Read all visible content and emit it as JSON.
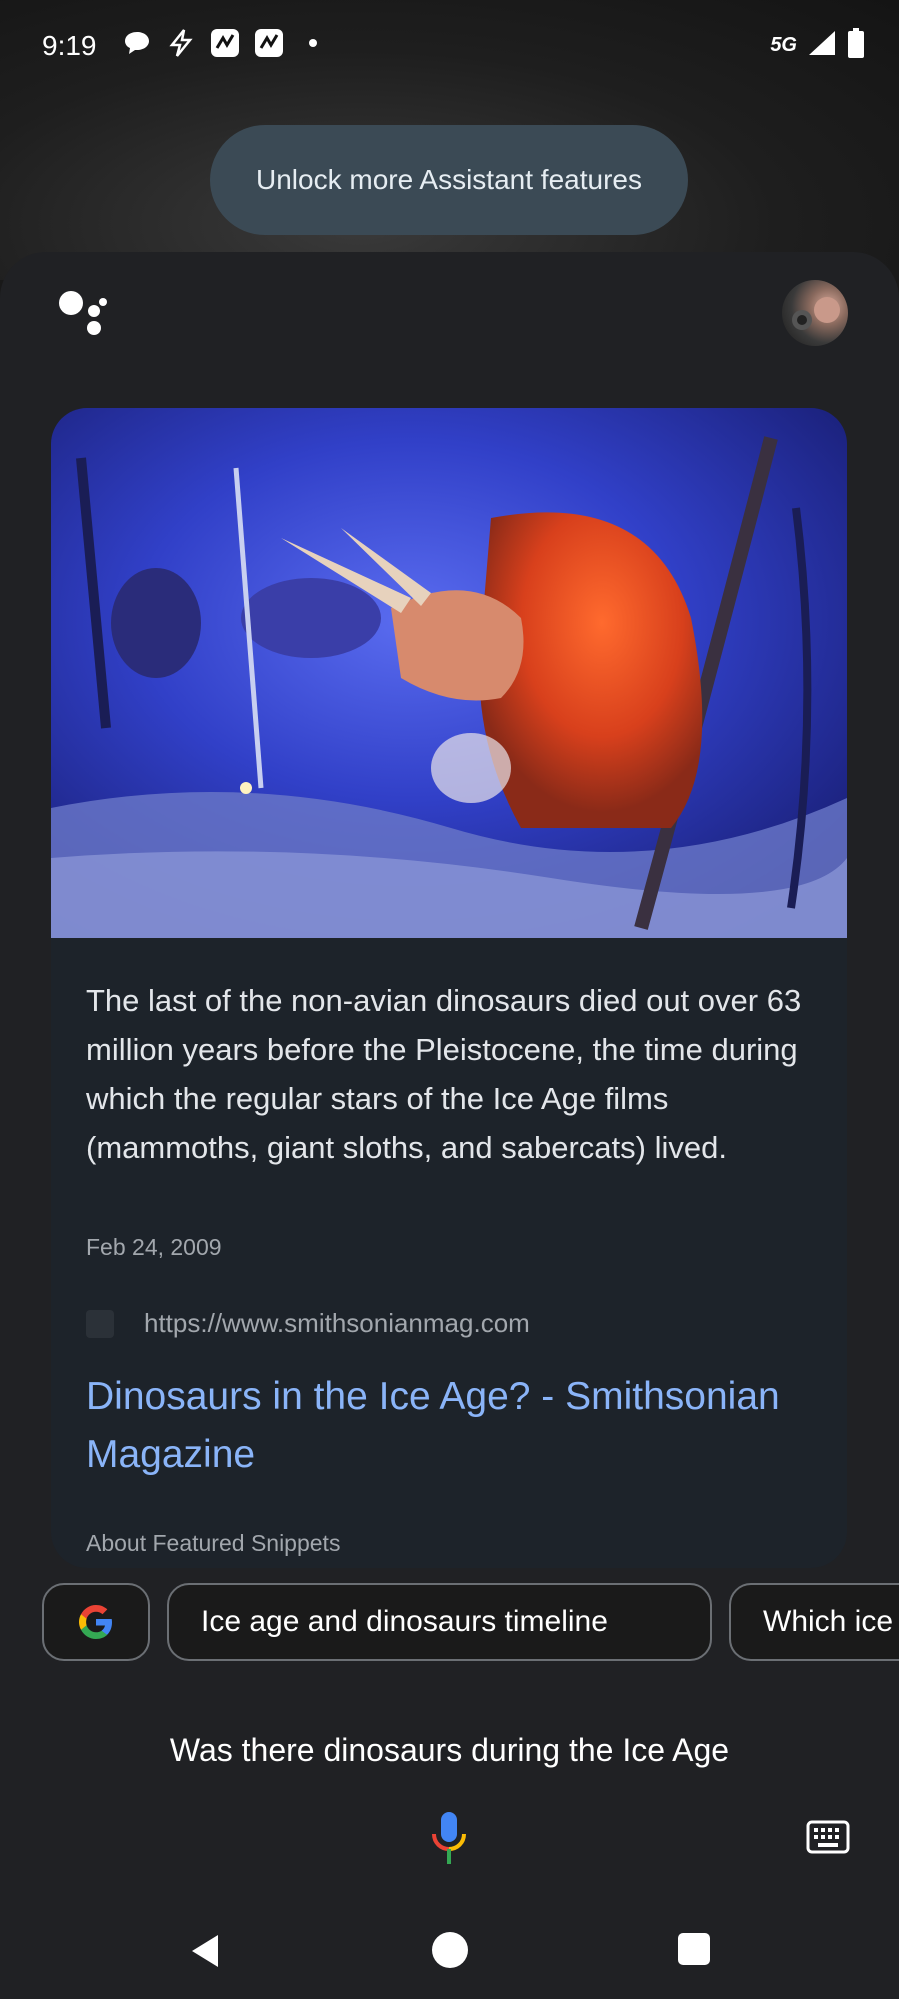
{
  "status_bar": {
    "time": "9:19",
    "notification_icons": [
      "chat-bubble-icon",
      "flash-icon",
      "app-notification-icon",
      "app-notification-icon",
      "dot-icon"
    ],
    "network_label": "5G",
    "signal_icon": "signal-icon",
    "battery_icon": "battery-icon"
  },
  "toast": {
    "text": "Unlock more Assistant features"
  },
  "header": {
    "logo_icon": "google-assistant-icon",
    "avatar_icon": "user-avatar"
  },
  "card": {
    "image_icon": "dinosaur-diorama-image",
    "snippet_text": "The last of the non-avian dinosaurs died out over 63 million years before the Pleistocene, the time during which the regular stars of the Ice Age films (mammoths, giant sloths, and sabercats) lived.",
    "date": "Feb 24, 2009",
    "source_url": "https://www.smithsonianmag.com",
    "title": "Dinosaurs in the Ice Age? - Smithsonian Magazine",
    "about_label": "About Featured Snippets"
  },
  "chips": {
    "google_icon": "google-g-icon",
    "items": [
      "Ice age and dinosaurs timeline",
      "Which ice"
    ]
  },
  "query": {
    "text": "Was there dinosaurs during the Ice Age"
  },
  "input_bar": {
    "mic_icon": "microphone-icon",
    "keyboard_icon": "keyboard-icon"
  },
  "nav_bar": {
    "back_icon": "back-icon",
    "home_icon": "home-icon",
    "recents_icon": "recents-icon"
  },
  "colors": {
    "link": "#8ab4f8",
    "card_bg": "#1d232a",
    "toast_bg": "#3b4a55",
    "sheet_bg": "#202124"
  }
}
